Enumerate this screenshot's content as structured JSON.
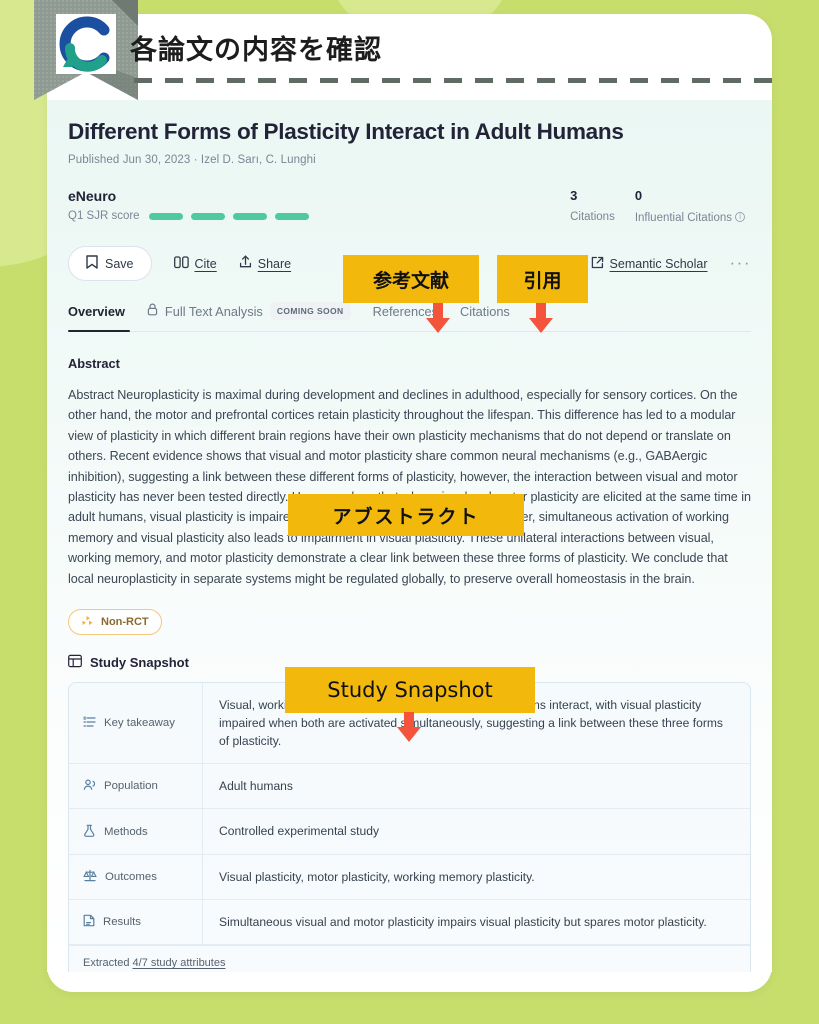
{
  "annotation": {
    "heading": "各論文の内容を確認",
    "callouts": [
      {
        "id": "references",
        "label": "参考文献"
      },
      {
        "id": "citations",
        "label": "引用"
      },
      {
        "id": "abstract",
        "label": "アブストラクト"
      },
      {
        "id": "snapshot",
        "label": "Study Snapshot"
      }
    ],
    "accent_color": "#f2b90c",
    "arrow_color": "#f4543c",
    "background_color": "#c7de6d"
  },
  "paper": {
    "title": "Different Forms of Plasticity Interact in Adult Humans",
    "byline": "Published Jun 30, 2023 · Izel D. Sarı, C. Lunghi",
    "journal": {
      "name": "eNeuro",
      "sjr_label": "Q1 SJR score",
      "sjr_filled_bars": 4,
      "bar_color": "#4ec9a0"
    },
    "metrics": [
      {
        "value": "3",
        "label": "Citations"
      },
      {
        "value": "0",
        "label": "Influential Citations",
        "has_info_icon": true
      }
    ]
  },
  "actions": {
    "save": "Save",
    "cite": "Cite",
    "share": "Share",
    "external": "Semantic Scholar",
    "more": "···"
  },
  "tabs": [
    {
      "label": "Overview",
      "active": true
    },
    {
      "label": "Full Text Analysis",
      "active": false,
      "icon": "lock-icon",
      "pill": "COMING SOON"
    },
    {
      "label": "References",
      "active": false
    },
    {
      "label": "Citations",
      "active": false
    }
  ],
  "abstract": {
    "heading": "Abstract",
    "text": "Abstract Neuroplasticity is maximal during development and declines in adulthood, especially for sensory cortices. On the other hand, the motor and prefrontal cortices retain plasticity throughout the lifespan. This difference has led to a modular view of plasticity in which different brain regions have their own plasticity mechanisms that do not depend or translate on others. Recent evidence shows that visual and motor plasticity share common neural mechanisms (e.g., GABAergic inhibition), suggesting a link between these different forms of plasticity, however, the interaction between visual and motor plasticity has never been tested directly. Here, we show that when visual and motor plasticity are elicited at the same time in adult humans, visual plasticity is impaired, while motor plasticity is spared. Moreover, simultaneous activation of working memory and visual plasticity also leads to impairment in visual plasticity. These unilateral interactions between visual, working memory, and motor plasticity demonstrate a clear link between these three forms of plasticity. We conclude that local neuroplasticity in separate systems might be regulated globally, to preserve overall homeostasis in the brain."
  },
  "badge": {
    "label": "Non-RCT"
  },
  "snapshot": {
    "heading": "Study Snapshot",
    "rows": [
      {
        "key": "Key takeaway",
        "icon": "list-icon",
        "value": "Visual, working memory, and motor plasticity in adult humans interact, with visual plasticity impaired when both are activated simultaneously, suggesting a link between these three forms of plasticity."
      },
      {
        "key": "Population",
        "icon": "people-icon",
        "value": "Adult humans"
      },
      {
        "key": "Methods",
        "icon": "flask-icon",
        "value": "Controlled experimental study"
      },
      {
        "key": "Outcomes",
        "icon": "scale-icon",
        "value": "Visual plasticity, motor plasticity, working memory plasticity."
      },
      {
        "key": "Results",
        "icon": "report-icon",
        "value": "Simultaneous visual and motor plasticity impairs visual plasticity but spares motor plasticity."
      }
    ],
    "footer_prefix": "Extracted ",
    "footer_link": "4/7 study attributes"
  }
}
